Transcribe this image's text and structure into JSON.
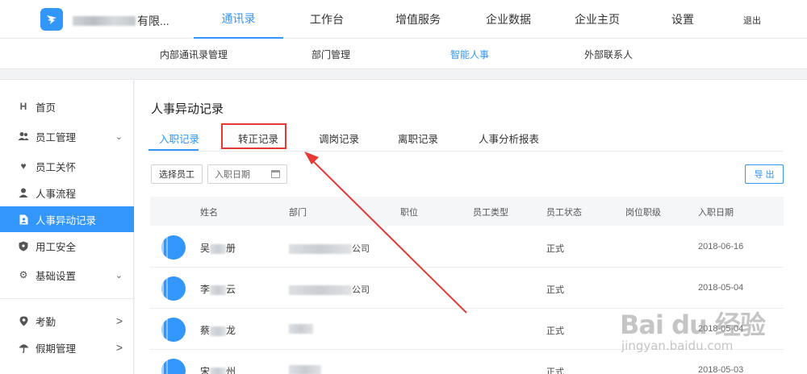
{
  "header": {
    "company_suffix": "有限...",
    "nav": [
      "通讯录",
      "工作台",
      "增值服务",
      "企业数据",
      "企业主页",
      "设置"
    ],
    "logout": "退出"
  },
  "subnav": [
    "内部通讯录管理",
    "部门管理",
    "智能人事",
    "外部联系人"
  ],
  "sidebar": {
    "items": [
      {
        "label": "首页",
        "icon": "home-icon"
      },
      {
        "label": "员工管理",
        "icon": "users-icon"
      },
      {
        "label": "员工关怀",
        "icon": "heart-icon"
      },
      {
        "label": "人事流程",
        "icon": "person-icon"
      },
      {
        "label": "人事异动记录",
        "icon": "document-icon"
      },
      {
        "label": "用工安全",
        "icon": "shield-icon"
      },
      {
        "label": "基础设置",
        "icon": "gear-icon"
      },
      {
        "label": "考勤",
        "icon": "location-icon"
      },
      {
        "label": "假期管理",
        "icon": "umbrella-icon"
      }
    ]
  },
  "main": {
    "title": "人事异动记录",
    "tabs": [
      "入职记录",
      "转正记录",
      "调岗记录",
      "离职记录",
      "人事分析报表"
    ],
    "select_employee": "选择员工",
    "date_placeholder": "入职日期",
    "export": "导 出"
  },
  "table": {
    "columns": [
      "姓名",
      "部门",
      "职位",
      "员工类型",
      "员工状态",
      "岗位职级",
      "入职日期"
    ],
    "rows": [
      {
        "name_first": "吴",
        "name_last": "册",
        "dept_suffix": "公司",
        "status": "正式",
        "date": "2018-06-16"
      },
      {
        "name_first": "李",
        "name_last": "云",
        "dept_suffix": "公司",
        "status": "正式",
        "date": "2018-05-04"
      },
      {
        "name_first": "蔡",
        "name_last": "龙",
        "dept_suffix": "",
        "status": "正式",
        "date": "2018-05-04"
      },
      {
        "name_first": "宋",
        "name_last": "州",
        "dept_suffix": "",
        "status": "正式",
        "date": "2018-05-03"
      }
    ]
  },
  "watermark": {
    "line1": "Bai du 经验",
    "line2": "jingyan.baidu.com"
  },
  "colors": {
    "accent": "#3296fa",
    "annotation": "#e53935"
  }
}
